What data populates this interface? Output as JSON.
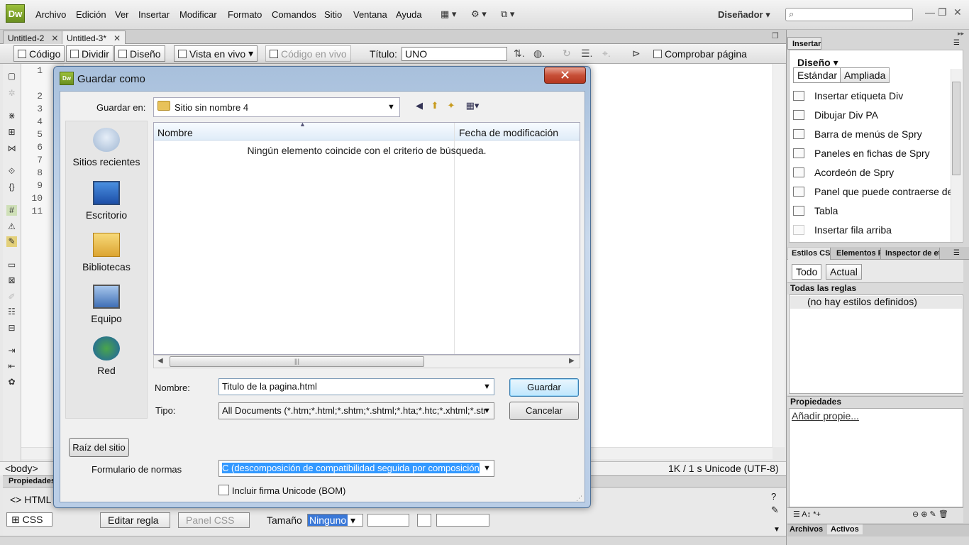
{
  "app": {
    "logo": "Dw",
    "menu": [
      "Archivo",
      "Edición",
      "Ver",
      "Insertar",
      "Modificar",
      "Formato",
      "Comandos",
      "Sitio",
      "Ventana",
      "Ayuda"
    ],
    "workspace": "Diseñador",
    "search_placeholder": ""
  },
  "doc_tabs": [
    {
      "label": "Untitled-2",
      "active": false
    },
    {
      "label": "Untitled-3*",
      "active": true
    }
  ],
  "doc_toolbar": {
    "code": "Código",
    "split": "Dividir",
    "design": "Diseño",
    "live_view": "Vista en vivo",
    "live_code": "Código en vivo",
    "title_label": "Título:",
    "title_value": "UNO",
    "check_page": "Comprobar página"
  },
  "editor": {
    "line_numbers": [
      "1",
      "2",
      "3",
      "4",
      "5",
      "6",
      "7",
      "8",
      "9",
      "10",
      "11"
    ],
    "tag_selector": "<body>",
    "status": "1K / 1 s  Unicode (UTF-8)"
  },
  "properties": {
    "title": "Propiedades",
    "html_toggle": "HTML",
    "css_toggle": "CSS",
    "edit_rule": "Editar regla",
    "css_panel": "Panel CSS",
    "size_label": "Tamaño",
    "size_value": "Ninguno"
  },
  "insert_panel": {
    "title": "Insertar",
    "category": "Diseño",
    "mode_standard": "Estándar",
    "mode_expanded": "Ampliada",
    "items": [
      "Insertar etiqueta Div",
      "Dibujar Div PA",
      "Barra de menús de Spry",
      "Paneles en fichas de Spry",
      "Acordeón de Spry",
      "Panel que puede contraerse de",
      "Tabla",
      "Insertar fila arriba"
    ]
  },
  "css_panel": {
    "tabs": [
      "Estilos CSS",
      "Elementos PA",
      "Inspector de eti"
    ],
    "mode_all": "Todo",
    "mode_current": "Actual",
    "rules_header": "Todas las reglas",
    "rules_empty": "(no hay estilos definidos)",
    "props_header": "Propiedades",
    "add_property": "Añadir propie..."
  },
  "files_tabs": [
    "Archivos",
    "Activos"
  ],
  "dialog": {
    "title": "Guardar como",
    "close_label": "✕",
    "look_in_label": "Guardar en:",
    "look_in_value": "Sitio sin nombre 4",
    "places": [
      "Sitios recientes",
      "Escritorio",
      "Bibliotecas",
      "Equipo",
      "Red"
    ],
    "columns": {
      "name": "Nombre",
      "date": "Fecha de modificación"
    },
    "empty_message": "Ningún elemento coincide con el criterio de búsqueda.",
    "filename_label": "Nombre:",
    "filename_value": "Titulo de la pagina.html",
    "type_label": "Tipo:",
    "type_value": "All Documents (*.htm;*.html;*.shtm;*.shtml;*.hta;*.htc;*.xhtml;*.str",
    "save_button": "Guardar",
    "cancel_button": "Cancelar",
    "site_root_button": "Raíz del sitio",
    "norms_label": "Formulario de normas",
    "norms_value": "C (descomposición de compatibilidad seguida por composición",
    "bom_label": "Incluir firma Unicode (BOM)",
    "bom_checked": false
  }
}
